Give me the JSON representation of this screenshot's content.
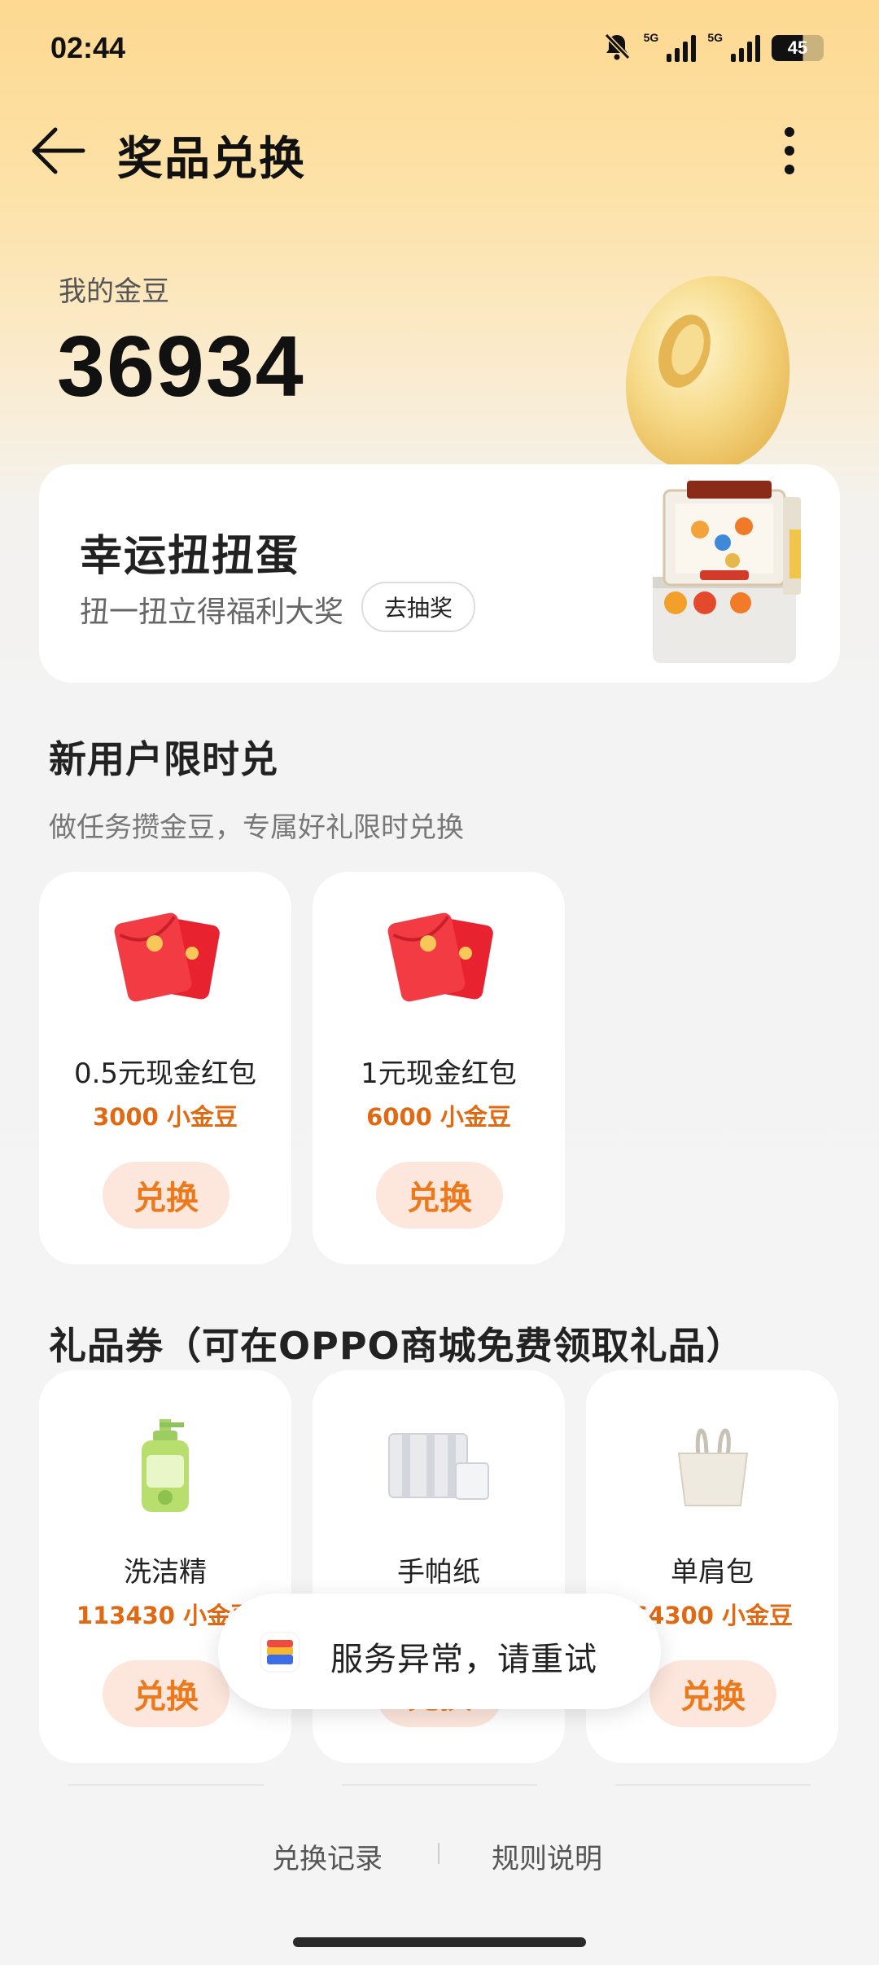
{
  "status_bar": {
    "time": "02:44",
    "network_1": "5G",
    "network_2": "5G",
    "battery": "45"
  },
  "header": {
    "title": "奖品兑换"
  },
  "balance": {
    "label": "我的金豆",
    "value": "36934"
  },
  "lucky": {
    "title": "幸运扭扭蛋",
    "subtitle": "扭一扭立得福利大奖",
    "button": "去抽奖"
  },
  "new_user": {
    "title": "新用户限时兑",
    "subtitle": "做任务攒金豆，专属好礼限时兑换",
    "items": [
      {
        "name": "0.5元现金红包",
        "price": "3000 小金豆",
        "button": "兑换",
        "icon": "red-envelope-icon"
      },
      {
        "name": "1元现金红包",
        "price": "6000 小金豆",
        "button": "兑换",
        "icon": "red-envelope-icon"
      }
    ]
  },
  "gifts": {
    "title": "礼品券（可在OPPO商城免费领取礼品）",
    "items": [
      {
        "name": "洗洁精",
        "price": "113430 小金豆",
        "button": "兑换",
        "icon": "detergent-bottle-icon"
      },
      {
        "name": "手帕纸",
        "price": "",
        "button": "兑换",
        "icon": "tissue-pack-icon"
      },
      {
        "name": "单肩包",
        "price": "64300 小金豆",
        "button": "兑换",
        "icon": "tote-bag-icon"
      }
    ]
  },
  "toast": {
    "text": "服务异常，请重试"
  },
  "footer": {
    "history": "兑换记录",
    "rules": "规则说明"
  },
  "colors": {
    "accent": "#e06a13",
    "button_bg": "#fde6dc",
    "button_text": "#ec7a1c"
  }
}
